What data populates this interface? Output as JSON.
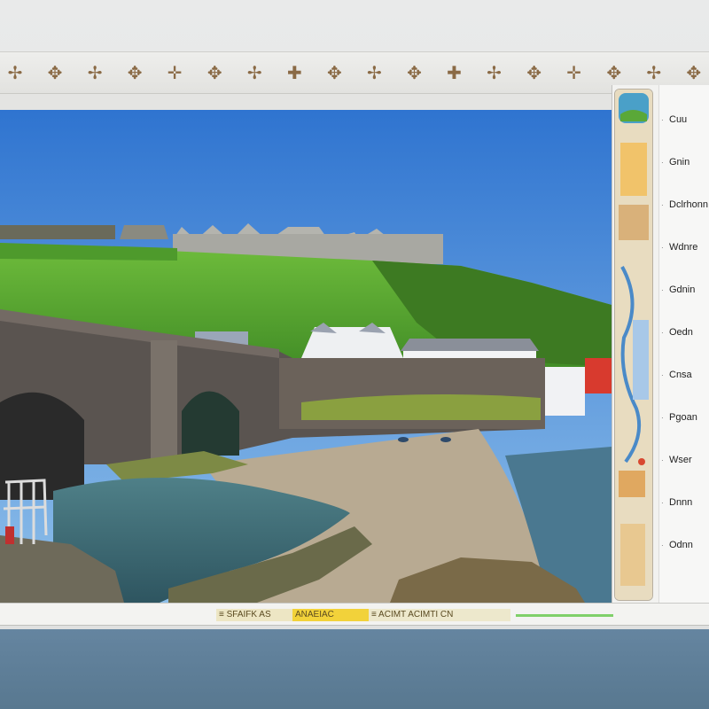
{
  "toolbar": {
    "tools": [
      {
        "name": "move-tool-icon",
        "glyph": "✢"
      },
      {
        "name": "pin-tool-icon",
        "glyph": "✥"
      },
      {
        "name": "marker-tool-icon",
        "glyph": "✢"
      },
      {
        "name": "transform-tool-icon",
        "glyph": "✥"
      },
      {
        "name": "crosshair-tool-icon",
        "glyph": "✛"
      },
      {
        "name": "anchor-tool-icon",
        "glyph": "✥"
      },
      {
        "name": "star-tool-icon",
        "glyph": "✢"
      },
      {
        "name": "plus-tool-icon",
        "glyph": "✚"
      },
      {
        "name": "guide-tool-icon",
        "glyph": "✥"
      },
      {
        "name": "select-tool-icon",
        "glyph": "✢"
      },
      {
        "name": "point-tool-icon",
        "glyph": "✥"
      },
      {
        "name": "add-tool-icon",
        "glyph": "✚"
      },
      {
        "name": "cross-tool-icon",
        "glyph": "✢"
      },
      {
        "name": "grid-tool-icon",
        "glyph": "✥"
      },
      {
        "name": "center-tool-icon",
        "glyph": "✛"
      },
      {
        "name": "split-tool-icon",
        "glyph": "✥"
      },
      {
        "name": "pan-tool-icon",
        "glyph": "✢"
      },
      {
        "name": "edge-tool-icon",
        "glyph": "✥"
      }
    ]
  },
  "panel": {
    "items": [
      {
        "label": "Cuu"
      },
      {
        "label": "Gnin"
      },
      {
        "label": "Dclrhonn"
      },
      {
        "label": "Wdnre"
      },
      {
        "label": "Gdnin"
      },
      {
        "label": "Oedn"
      },
      {
        "label": "Cnsa"
      },
      {
        "label": "Pgoan"
      },
      {
        "label": "Wser"
      },
      {
        "label": "Dnnn"
      },
      {
        "label": "Odnn"
      }
    ]
  },
  "status": {
    "segments": [
      "≡ SFAIFK AS",
      "ANAEIAC",
      "≡ ACIMT ACIMTI CN"
    ]
  },
  "colors": {
    "sky": "#3f7fd4",
    "grass": "#5fae35",
    "stone": "#5a5450",
    "water": "#3c6a72",
    "status_highlight": "#f2d23a",
    "progress": "#7fd06a"
  }
}
